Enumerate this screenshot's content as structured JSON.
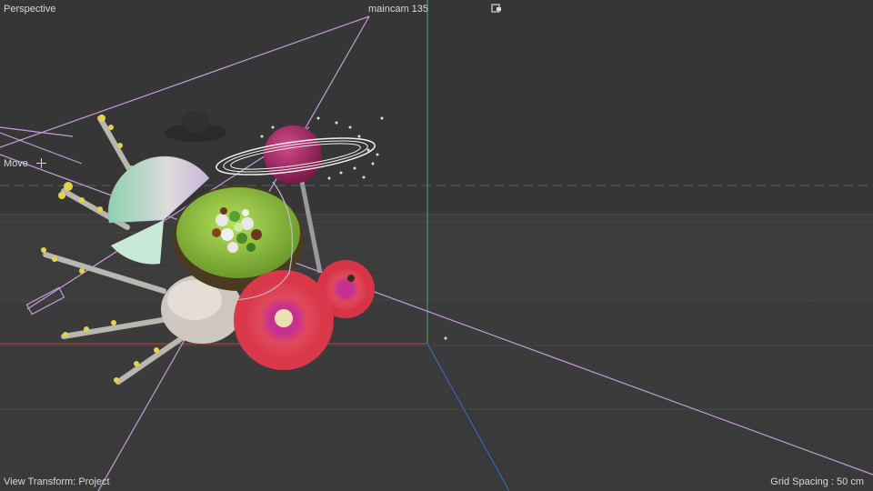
{
  "viewport": {
    "view_name": "Perspective",
    "camera_name": "maincam 135",
    "active_tool": "Move",
    "view_transform": "View Transform: Project",
    "grid_spacing": "Grid Spacing : 50 cm"
  },
  "icons": {
    "camera": "camera-link-icon",
    "move_tool": "move-crosshair-icon"
  },
  "colors": {
    "background": "#3a3a3a",
    "hud_text": "#d8d8d8",
    "axis_x": "#b84040",
    "axis_y": "#4fa86a",
    "axis_z": "#3a6acc",
    "selection": "#c89ad8"
  },
  "scene": {
    "objects": [
      "yellow-flower-stalks",
      "paper-fan",
      "dandelion-seedhead",
      "kiwi-bowl",
      "candy-balls",
      "magenta-planet",
      "planet-ring",
      "spring-shell",
      "red-flower-large",
      "red-flower-small",
      "dark-hat",
      "scattered-particles"
    ]
  }
}
